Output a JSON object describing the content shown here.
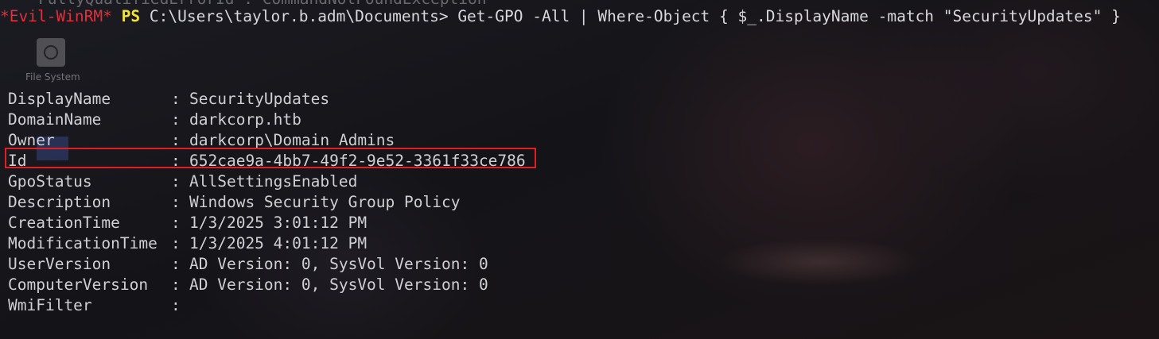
{
  "window": {
    "ghost_text": "FullyQualifiedErrorId : CommandNotFoundException",
    "desktop_icon_label": "File System",
    "desktop_icon_name": "drive-icon"
  },
  "prompt": {
    "tag": "*Evil-WinRM*",
    "ps": "PS",
    "path": "C:\\Users\\taylor.b.adm\\Documents>",
    "command": "Get-GPO -All | Where-Object { $_.DisplayName -match \"SecurityUpdates\" }"
  },
  "output": [
    {
      "key": "DisplayName",
      "value": "SecurityUpdates"
    },
    {
      "key": "DomainName",
      "value": "darkcorp.htb"
    },
    {
      "key": "Owner",
      "value": "darkcorp\\Domain Admins"
    },
    {
      "key": "Id",
      "value": "652cae9a-4bb7-49f2-9e52-3361f33ce786"
    },
    {
      "key": "GpoStatus",
      "value": "AllSettingsEnabled"
    },
    {
      "key": "Description",
      "value": "Windows Security Group Policy"
    },
    {
      "key": "CreationTime",
      "value": "1/3/2025 3:01:12 PM"
    },
    {
      "key": "ModificationTime",
      "value": "1/3/2025 4:01:12 PM"
    },
    {
      "key": "UserVersion",
      "value": "AD Version: 0, SysVol Version: 0"
    },
    {
      "key": "ComputerVersion",
      "value": "AD Version: 0, SysVol Version: 0"
    },
    {
      "key": "WmiFilter",
      "value": ""
    }
  ],
  "separator": ":",
  "colors": {
    "prompt_tag": "#e0303a",
    "prompt_ps": "#f2e23a",
    "highlight": "#e02020",
    "text": "#d8d8dc"
  }
}
